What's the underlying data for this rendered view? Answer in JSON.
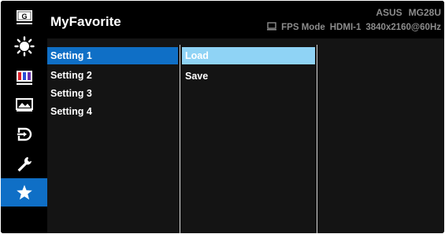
{
  "header": {
    "title": "MyFavorite",
    "brand": "ASUS",
    "model": "MG28U",
    "mode": "FPS Mode",
    "input": "HDMI-1",
    "resolution": "3840x2160@60Hz"
  },
  "sidebar": {
    "items": [
      {
        "icon": "gameplus-icon"
      },
      {
        "icon": "brightness-icon"
      },
      {
        "icon": "color-icon"
      },
      {
        "icon": "image-icon"
      },
      {
        "icon": "input-select-icon"
      },
      {
        "icon": "system-setup-icon"
      },
      {
        "icon": "favorite-star-icon",
        "active": true
      }
    ]
  },
  "menu": {
    "settings": [
      "Setting 1",
      "Setting 2",
      "Setting 3",
      "Setting 4"
    ],
    "selected_setting": "Setting 1",
    "actions": [
      "Load",
      "Save"
    ],
    "selected_action": "Load"
  },
  "colors": {
    "active_blue": "#0f6fc6",
    "highlight_light_blue": "#8fd3f5",
    "status_gray": "#8c8c8c"
  }
}
